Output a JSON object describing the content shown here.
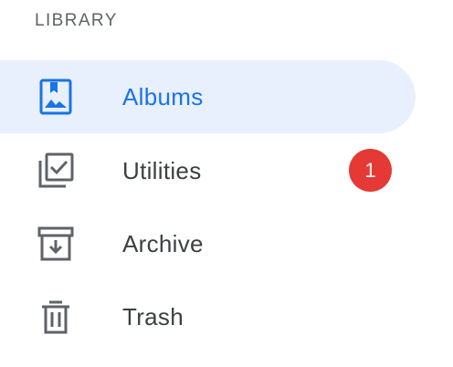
{
  "sidebar": {
    "section_header": "LIBRARY",
    "items": [
      {
        "label": "Albums",
        "icon": "album-icon",
        "active": true
      },
      {
        "label": "Utilities",
        "icon": "utilities-icon",
        "badge": "1"
      },
      {
        "label": "Archive",
        "icon": "archive-icon"
      },
      {
        "label": "Trash",
        "icon": "trash-icon"
      }
    ]
  },
  "colors": {
    "accent": "#1a73e8",
    "active_background": "#e8f0fe",
    "badge": "#e53935",
    "text": "#3c4043",
    "icon": "#5f6368"
  }
}
